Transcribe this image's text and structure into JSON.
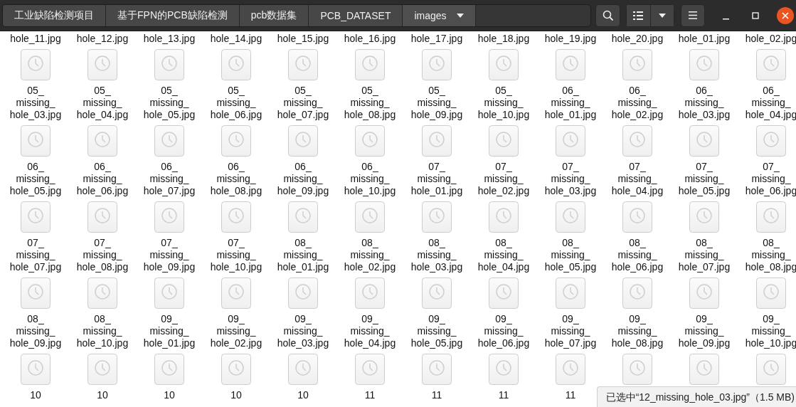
{
  "path_bar": {
    "segments": [
      {
        "label": "工业缺陷检测项目",
        "selected": false
      },
      {
        "label": "基于FPN的PCB缺陷检测",
        "selected": false
      },
      {
        "label": "pcb数据集",
        "selected": false
      },
      {
        "label": "PCB_DATASET",
        "selected": false
      },
      {
        "label": "images",
        "selected": true
      }
    ]
  },
  "files": [
    {
      "kind": "label-only",
      "name": "hole_11.jpg"
    },
    {
      "kind": "label-only",
      "name": "hole_12.jpg"
    },
    {
      "kind": "label-only",
      "name": "hole_13.jpg"
    },
    {
      "kind": "label-only",
      "name": "hole_14.jpg"
    },
    {
      "kind": "label-only",
      "name": "hole_15.jpg"
    },
    {
      "kind": "label-only",
      "name": "hole_16.jpg"
    },
    {
      "kind": "label-only",
      "name": "hole_17.jpg"
    },
    {
      "kind": "label-only",
      "name": "hole_18.jpg"
    },
    {
      "kind": "label-only",
      "name": "hole_19.jpg"
    },
    {
      "kind": "label-only",
      "name": "hole_20.jpg"
    },
    {
      "kind": "label-only",
      "name": "hole_01.jpg"
    },
    {
      "kind": "label-only",
      "name": "hole_02.jpg"
    },
    {
      "kind": "full",
      "name": "05_\nmissing_\nhole_03.jpg"
    },
    {
      "kind": "full",
      "name": "05_\nmissing_\nhole_04.jpg"
    },
    {
      "kind": "full",
      "name": "05_\nmissing_\nhole_05.jpg"
    },
    {
      "kind": "full",
      "name": "05_\nmissing_\nhole_06.jpg"
    },
    {
      "kind": "full",
      "name": "05_\nmissing_\nhole_07.jpg"
    },
    {
      "kind": "full",
      "name": "05_\nmissing_\nhole_08.jpg"
    },
    {
      "kind": "full",
      "name": "05_\nmissing_\nhole_09.jpg"
    },
    {
      "kind": "full",
      "name": "05_\nmissing_\nhole_10.jpg"
    },
    {
      "kind": "full",
      "name": "06_\nmissing_\nhole_01.jpg"
    },
    {
      "kind": "full",
      "name": "06_\nmissing_\nhole_02.jpg"
    },
    {
      "kind": "full",
      "name": "06_\nmissing_\nhole_03.jpg"
    },
    {
      "kind": "full",
      "name": "06_\nmissing_\nhole_04.jpg"
    },
    {
      "kind": "full",
      "name": "06_\nmissing_\nhole_05.jpg"
    },
    {
      "kind": "full",
      "name": "06_\nmissing_\nhole_06.jpg"
    },
    {
      "kind": "full",
      "name": "06_\nmissing_\nhole_07.jpg"
    },
    {
      "kind": "full",
      "name": "06_\nmissing_\nhole_08.jpg"
    },
    {
      "kind": "full",
      "name": "06_\nmissing_\nhole_09.jpg"
    },
    {
      "kind": "full",
      "name": "06_\nmissing_\nhole_10.jpg"
    },
    {
      "kind": "full",
      "name": "07_\nmissing_\nhole_01.jpg"
    },
    {
      "kind": "full",
      "name": "07_\nmissing_\nhole_02.jpg"
    },
    {
      "kind": "full",
      "name": "07_\nmissing_\nhole_03.jpg"
    },
    {
      "kind": "full",
      "name": "07_\nmissing_\nhole_04.jpg"
    },
    {
      "kind": "full",
      "name": "07_\nmissing_\nhole_05.jpg"
    },
    {
      "kind": "full",
      "name": "07_\nmissing_\nhole_06.jpg"
    },
    {
      "kind": "full",
      "name": "07_\nmissing_\nhole_07.jpg"
    },
    {
      "kind": "full",
      "name": "07_\nmissing_\nhole_08.jpg"
    },
    {
      "kind": "full",
      "name": "07_\nmissing_\nhole_09.jpg"
    },
    {
      "kind": "full",
      "name": "07_\nmissing_\nhole_10.jpg"
    },
    {
      "kind": "full",
      "name": "08_\nmissing_\nhole_01.jpg"
    },
    {
      "kind": "full",
      "name": "08_\nmissing_\nhole_02.jpg"
    },
    {
      "kind": "full",
      "name": "08_\nmissing_\nhole_03.jpg"
    },
    {
      "kind": "full",
      "name": "08_\nmissing_\nhole_04.jpg"
    },
    {
      "kind": "full",
      "name": "08_\nmissing_\nhole_05.jpg"
    },
    {
      "kind": "full",
      "name": "08_\nmissing_\nhole_06.jpg"
    },
    {
      "kind": "full",
      "name": "08_\nmissing_\nhole_07.jpg"
    },
    {
      "kind": "full",
      "name": "08_\nmissing_\nhole_08.jpg"
    },
    {
      "kind": "full",
      "name": "08_\nmissing_\nhole_09.jpg"
    },
    {
      "kind": "full",
      "name": "08_\nmissing_\nhole_10.jpg"
    },
    {
      "kind": "full",
      "name": "09_\nmissing_\nhole_01.jpg"
    },
    {
      "kind": "full",
      "name": "09_\nmissing_\nhole_02.jpg"
    },
    {
      "kind": "full",
      "name": "09_\nmissing_\nhole_03.jpg"
    },
    {
      "kind": "full",
      "name": "09_\nmissing_\nhole_04.jpg"
    },
    {
      "kind": "full",
      "name": "09_\nmissing_\nhole_05.jpg"
    },
    {
      "kind": "full",
      "name": "09_\nmissing_\nhole_06.jpg"
    },
    {
      "kind": "full",
      "name": "09_\nmissing_\nhole_07.jpg"
    },
    {
      "kind": "full",
      "name": "09_\nmissing_\nhole_08.jpg"
    },
    {
      "kind": "full",
      "name": "09_\nmissing_\nhole_09.jpg"
    },
    {
      "kind": "full",
      "name": "09_\nmissing_\nhole_10.jpg"
    },
    {
      "kind": "full",
      "name": "10"
    },
    {
      "kind": "full",
      "name": "10"
    },
    {
      "kind": "full",
      "name": "10"
    },
    {
      "kind": "full",
      "name": "10"
    },
    {
      "kind": "full",
      "name": "10"
    },
    {
      "kind": "full",
      "name": "11"
    },
    {
      "kind": "full",
      "name": "11"
    },
    {
      "kind": "full",
      "name": "11"
    },
    {
      "kind": "full",
      "name": "11"
    },
    {
      "kind": "icon-only"
    },
    {
      "kind": "icon-only"
    },
    {
      "kind": "icon-only"
    }
  ],
  "status_bar": {
    "text": "已选中“12_missing_hole_03.jpg”（1.5 MB)"
  }
}
